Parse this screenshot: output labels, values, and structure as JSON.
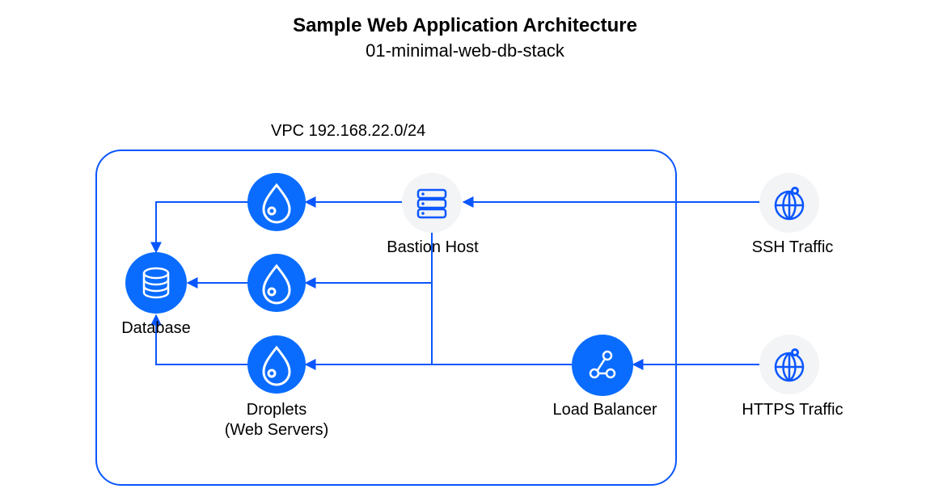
{
  "title": "Sample Web Application Architecture",
  "subtitle": "01-minimal-web-db-stack",
  "vpc_label": "VPC 192.168.22.0/24",
  "nodes": {
    "database": {
      "label": "Database"
    },
    "droplets": {
      "label_line1": "Droplets",
      "label_line2": "(Web Servers)"
    },
    "bastion": {
      "label": "Bastion Host"
    },
    "lb": {
      "label": "Load Balancer"
    },
    "ssh": {
      "label": "SSH Traffic"
    },
    "https": {
      "label": "HTTPS Traffic"
    }
  },
  "colors": {
    "blue": "#0a56ff",
    "iconbg": "#f2f4f6"
  },
  "edges": [
    {
      "from": "ssh",
      "to": "bastion"
    },
    {
      "from": "https",
      "to": "lb"
    },
    {
      "from": "lb",
      "to": "droplet3",
      "via": "bastion-column"
    },
    {
      "from": "bastion",
      "to": "droplet1"
    },
    {
      "from": "bastion",
      "to": "droplet2"
    },
    {
      "from": "bastion",
      "to": "droplet3"
    },
    {
      "from": "droplet1",
      "to": "database"
    },
    {
      "from": "droplet2",
      "to": "database"
    },
    {
      "from": "droplet3",
      "to": "database"
    }
  ]
}
